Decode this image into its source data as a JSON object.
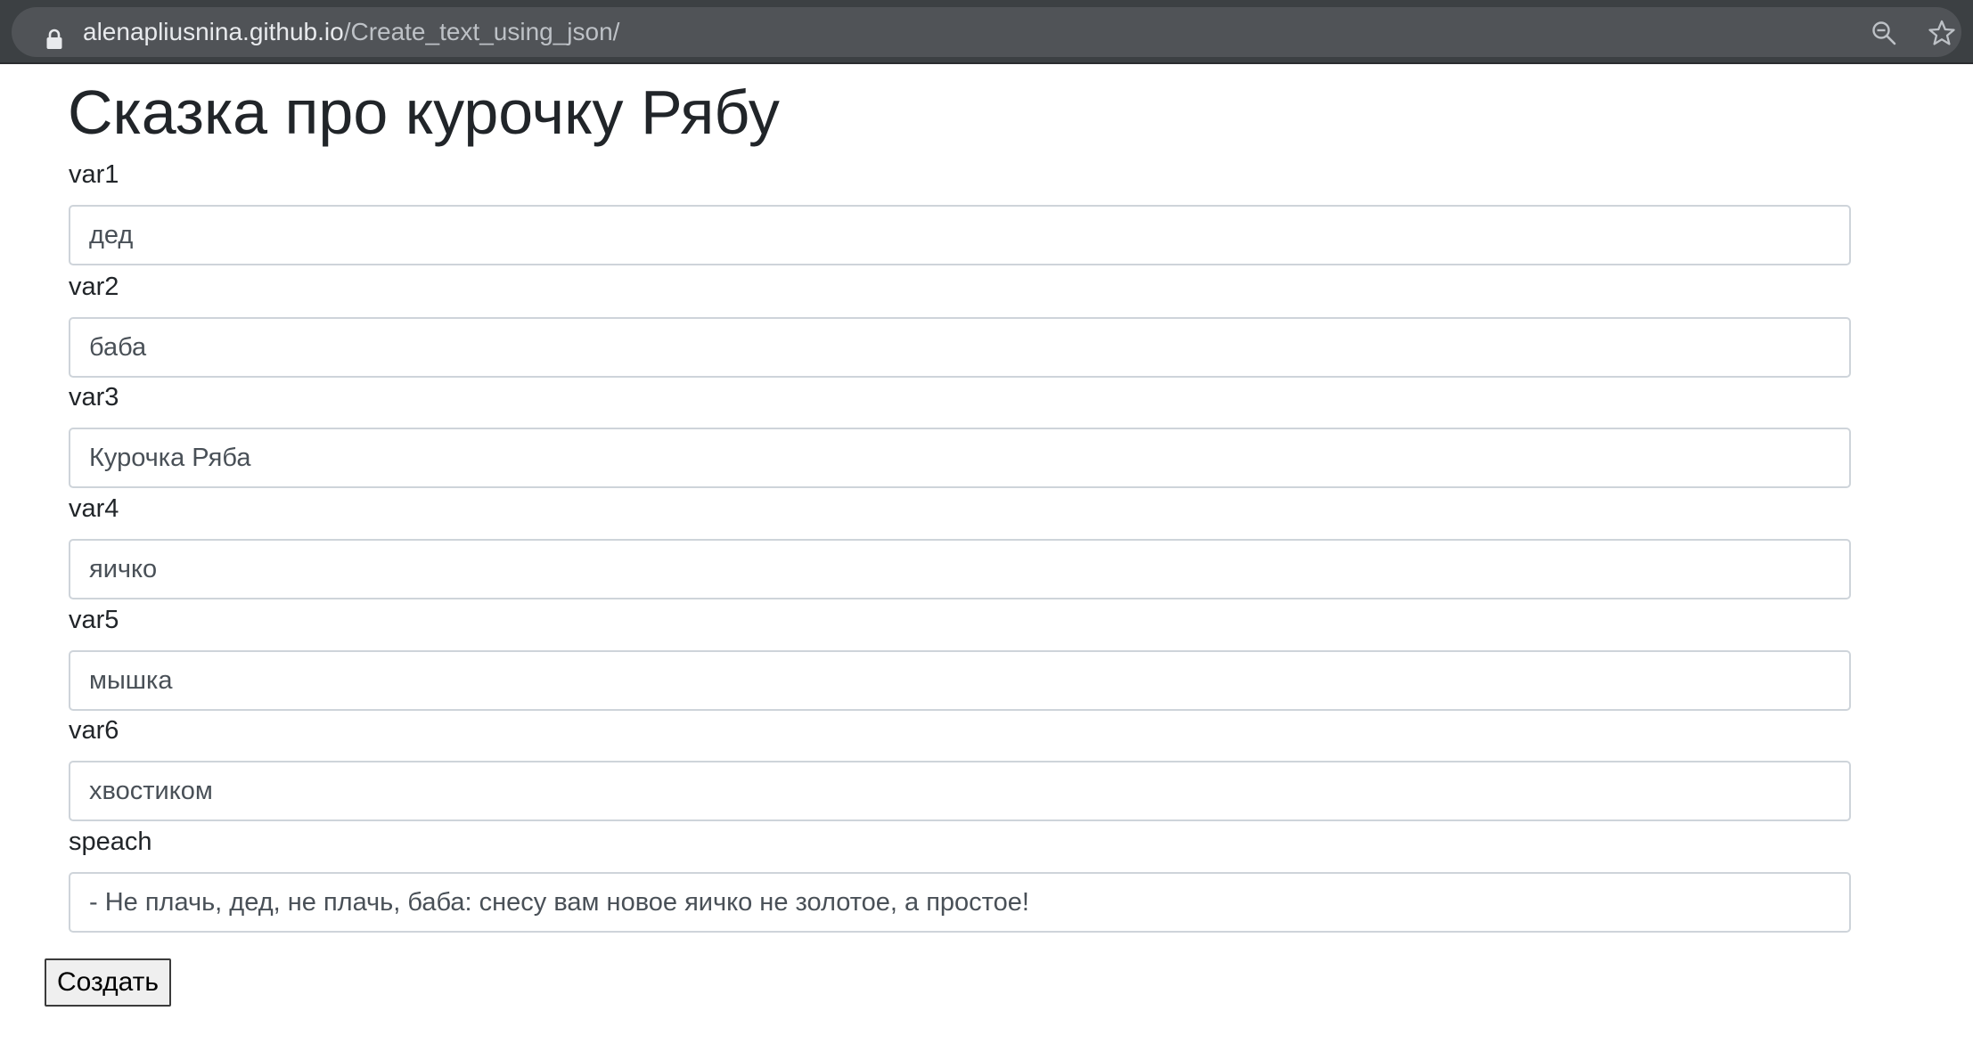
{
  "browser": {
    "url_host": "alenapliusnina.github.io",
    "url_path": "/Create_text_using_json/",
    "icons": [
      "lock-icon",
      "zoom-out-icon",
      "bookmark-star-icon"
    ]
  },
  "page": {
    "title": "Сказка про курочку Рябу"
  },
  "form": {
    "fields": [
      {
        "label": "var1",
        "value": "дед"
      },
      {
        "label": "var2",
        "value": "баба"
      },
      {
        "label": "var3",
        "value": "Курочка Ряба"
      },
      {
        "label": "var4",
        "value": "яичко"
      },
      {
        "label": "var5",
        "value": "мышка"
      },
      {
        "label": "var6",
        "value": "хвостиком"
      },
      {
        "label": "speach",
        "value": "- Не плачь, дед, не плачь, баба: снесу вам новое яичко не золотое, а простое!"
      }
    ],
    "submit_label": "Создать"
  }
}
